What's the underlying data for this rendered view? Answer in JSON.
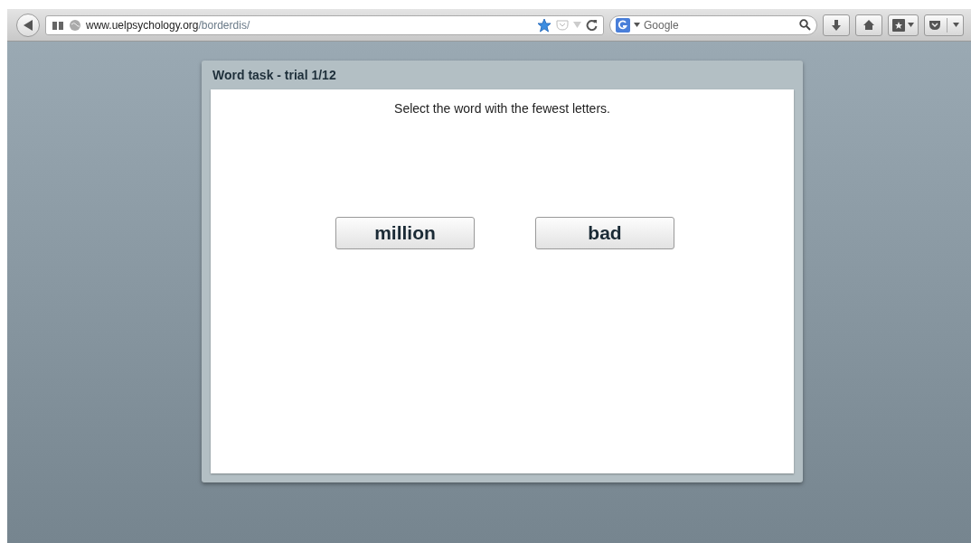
{
  "browser": {
    "url": {
      "host": "www.uelpsychology.org",
      "path": "/borderdis/"
    },
    "search": {
      "placeholder": "Google"
    },
    "bookmarked": true
  },
  "task": {
    "title": "Word task - trial 1/12",
    "instruction": "Select the word with the fewest letters.",
    "choices": [
      {
        "label": "million"
      },
      {
        "label": "bad"
      }
    ]
  }
}
